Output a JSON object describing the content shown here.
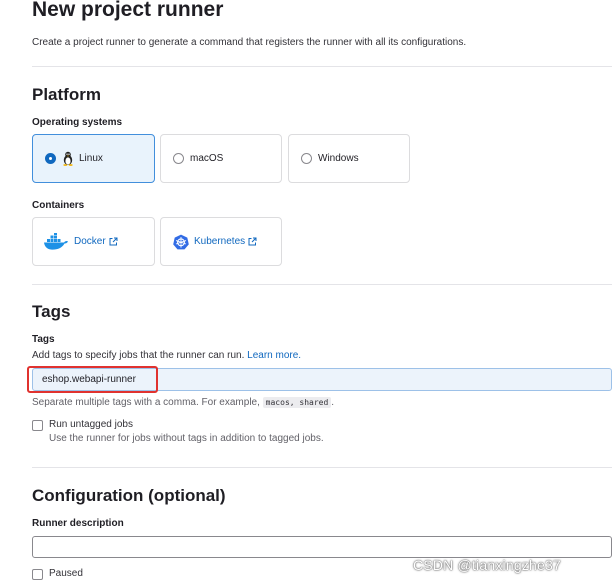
{
  "header": {
    "title": "New project runner",
    "description": "Create a project runner to generate a command that registers the runner with all its configurations."
  },
  "platform": {
    "title": "Platform",
    "os_label": "Operating systems",
    "os_options": [
      {
        "label": "Linux",
        "selected": true,
        "icon": "linux-tux-icon"
      },
      {
        "label": "macOS",
        "selected": false
      },
      {
        "label": "Windows",
        "selected": false
      }
    ],
    "containers_label": "Containers",
    "containers": [
      {
        "label": "Docker",
        "icon": "docker-icon"
      },
      {
        "label": "Kubernetes",
        "icon": "kubernetes-icon"
      }
    ]
  },
  "tags": {
    "title": "Tags",
    "field_label": "Tags",
    "help_text": "Add tags to specify jobs that the runner can run.",
    "learn_more": "Learn more.",
    "value": "eshop.webapi-runner",
    "separator_hint_prefix": "Separate multiple tags with a comma. For example,",
    "separator_example": "macos, shared",
    "separator_hint_suffix": ".",
    "run_untagged_label": "Run untagged jobs",
    "run_untagged_help": "Use the runner for jobs without tags in addition to tagged jobs."
  },
  "configuration": {
    "title": "Configuration (optional)",
    "description_label": "Runner description",
    "description_value": "",
    "paused_label": "Paused"
  },
  "watermark": "CSDN @tianxingzhe37",
  "colors": {
    "link": "#1068bf",
    "selected_border": "#428fdc",
    "selected_bg": "#e9f3fc",
    "highlight": "#e0322f"
  }
}
